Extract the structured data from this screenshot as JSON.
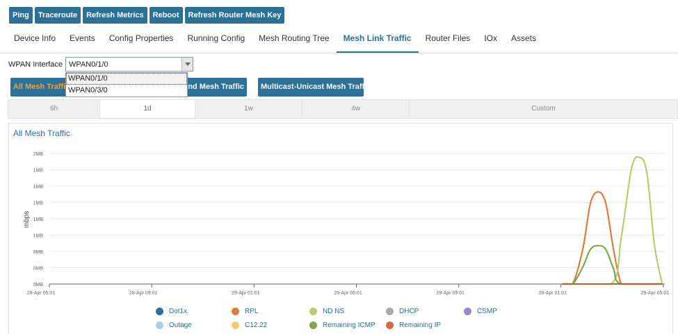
{
  "toolbar": {
    "buttons": [
      "Ping",
      "Traceroute",
      "Refresh Metrics",
      "Reboot",
      "Refresh Router Mesh Key"
    ]
  },
  "tabs": [
    "Device Info",
    "Events",
    "Config Properties",
    "Running Config",
    "Mesh Routing Tree",
    "Mesh Link Traffic",
    "Router Files",
    "IOx",
    "Assets"
  ],
  "active_tab": "Mesh Link Traffic",
  "wpan": {
    "label": "WPAN Interface",
    "selected": "WPAN0/1/0",
    "options": [
      "WPAN0/1/0",
      "WPAN0/3/0"
    ]
  },
  "traffic_buttons": [
    "All Mesh Traffic",
    "Inbound Mesh Traffic",
    "Multicast-Unicast Mesh Traffic"
  ],
  "time_ranges": [
    "6h",
    "1d",
    "1w",
    "4w",
    "Custom"
  ],
  "active_range": "1d",
  "chart_data": {
    "type": "line",
    "title": "All Mesh Traffic",
    "ylabel": "mbps",
    "y_tick_labels": [
      "0MB",
      "0MB",
      "0MB",
      "1MB",
      "1MB",
      "1MB",
      "1MB",
      "1MB",
      "2MB"
    ],
    "x_tick_labels": [
      "28-Apr 05:01",
      "28-Apr 09:01",
      "29-Apr 01:01",
      "29-Apr 05:01",
      "29-Apr 09:01",
      "29-Apr 01:01",
      "29-Apr 05:01"
    ],
    "x_range_hours": [
      0,
      24
    ],
    "y_range": [
      0,
      1.7
    ],
    "grid": true,
    "legend_position": "bottom",
    "series": [
      {
        "name": "Dot1x",
        "color": "#2e6f96",
        "x": [],
        "y": []
      },
      {
        "name": "RPL",
        "color": "#e07b39",
        "x": [
          20.0,
          20.4,
          20.8,
          21.1,
          21.4,
          21.7,
          22.0,
          22.3,
          22.6,
          23.0,
          23.5,
          23.9
        ],
        "y": [
          0,
          0,
          0.45,
          1.05,
          1.2,
          1.05,
          0.45,
          0,
          0,
          0,
          0,
          0
        ]
      },
      {
        "name": "ND NS",
        "color": "#b5cf6b",
        "x": [
          20.0,
          21.9,
          22.3,
          22.7,
          23.0,
          23.3,
          23.6,
          23.9
        ],
        "y": [
          0,
          0,
          0.6,
          1.5,
          1.65,
          1.45,
          0.5,
          0
        ]
      },
      {
        "name": "DHCP",
        "color": "#a9a9a9",
        "x": [],
        "y": []
      },
      {
        "name": "CSMP",
        "color": "#9b87c4",
        "x": [],
        "y": []
      },
      {
        "name": "Outage",
        "color": "#a7d3df",
        "x": [],
        "y": []
      },
      {
        "name": "C12.22",
        "color": "#f0cc6b",
        "x": [],
        "y": []
      },
      {
        "name": "Remaining ICMP",
        "color": "#79a94a",
        "x": [
          20.0,
          20.4,
          20.8,
          21.1,
          21.4,
          21.7,
          22.0,
          22.3,
          23.9
        ],
        "y": [
          0,
          0,
          0.22,
          0.45,
          0.5,
          0.45,
          0.2,
          0,
          0
        ]
      },
      {
        "name": "Remaining IP",
        "color": "#d9674a",
        "x": [],
        "y": []
      }
    ]
  }
}
